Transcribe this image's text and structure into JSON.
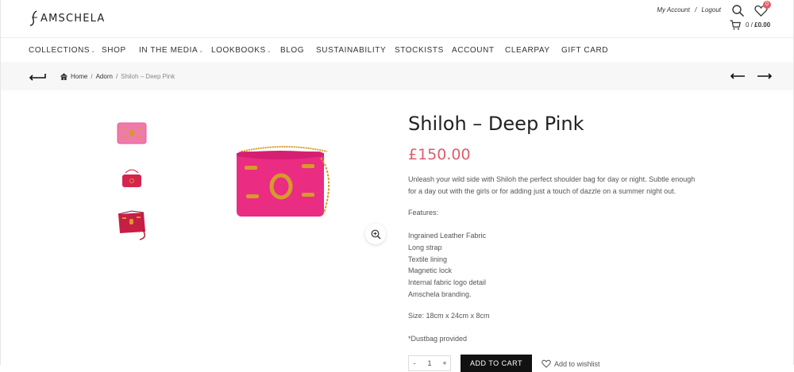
{
  "brand": {
    "name": "AMSCHELA",
    "logo_icon": "amschela-logo-icon"
  },
  "header": {
    "my_account": "My Account",
    "separator": "/",
    "logout": "Logout",
    "wishlist_count": "0",
    "cart_count": "0",
    "cart_sep": "/",
    "cart_total": "£0.00"
  },
  "nav": {
    "items": [
      {
        "label": "COLLECTIONS",
        "has_dropdown": true
      },
      {
        "label": "SHOP",
        "has_dropdown": false
      },
      {
        "label": "IN THE MEDIA",
        "has_dropdown": true
      },
      {
        "label": "LOOKBOOKS",
        "has_dropdown": true
      },
      {
        "label": "BLOG",
        "has_dropdown": false
      },
      {
        "label": "SUSTAINABILITY",
        "has_dropdown": false
      },
      {
        "label": "STOCKISTS",
        "has_dropdown": false
      },
      {
        "label": "ACCOUNT",
        "has_dropdown": false
      },
      {
        "label": "CLEARPAY",
        "has_dropdown": false
      },
      {
        "label": "GIFT CARD",
        "has_dropdown": false
      }
    ],
    "caret": "⌄"
  },
  "breadcrumb": {
    "home": "Home",
    "sep": "/",
    "category": "Adorn",
    "current": "Shiloh – Deep Pink"
  },
  "product": {
    "title": "Shiloh – Deep Pink",
    "price": "£150.00",
    "description": "Unleash your wild side with Shiloh the perfect shoulder bag for day or night. Subtle enough for a day out with the girls or for adding just a touch of dazzle on a summer night out.",
    "features_heading": "Features:",
    "features": [
      "Ingrained Leather Fabric",
      "Long strap",
      "Textile lining",
      "Magnetic lock",
      "Internal fabric logo detail",
      "Amschela branding."
    ],
    "size": "Size: 18cm x 24cm x 8cm",
    "dustbag": "*Dustbag provided",
    "qty_minus": "-",
    "qty_value": "1",
    "qty_plus": "+",
    "add_to_cart": "ADD TO CART",
    "add_to_wishlist": "Add to wishlist"
  },
  "colors": {
    "accent_price": "#e05c6d",
    "bag_pink": "#e8307c",
    "bag_red": "#c9203f",
    "gold": "#d69a2a"
  }
}
